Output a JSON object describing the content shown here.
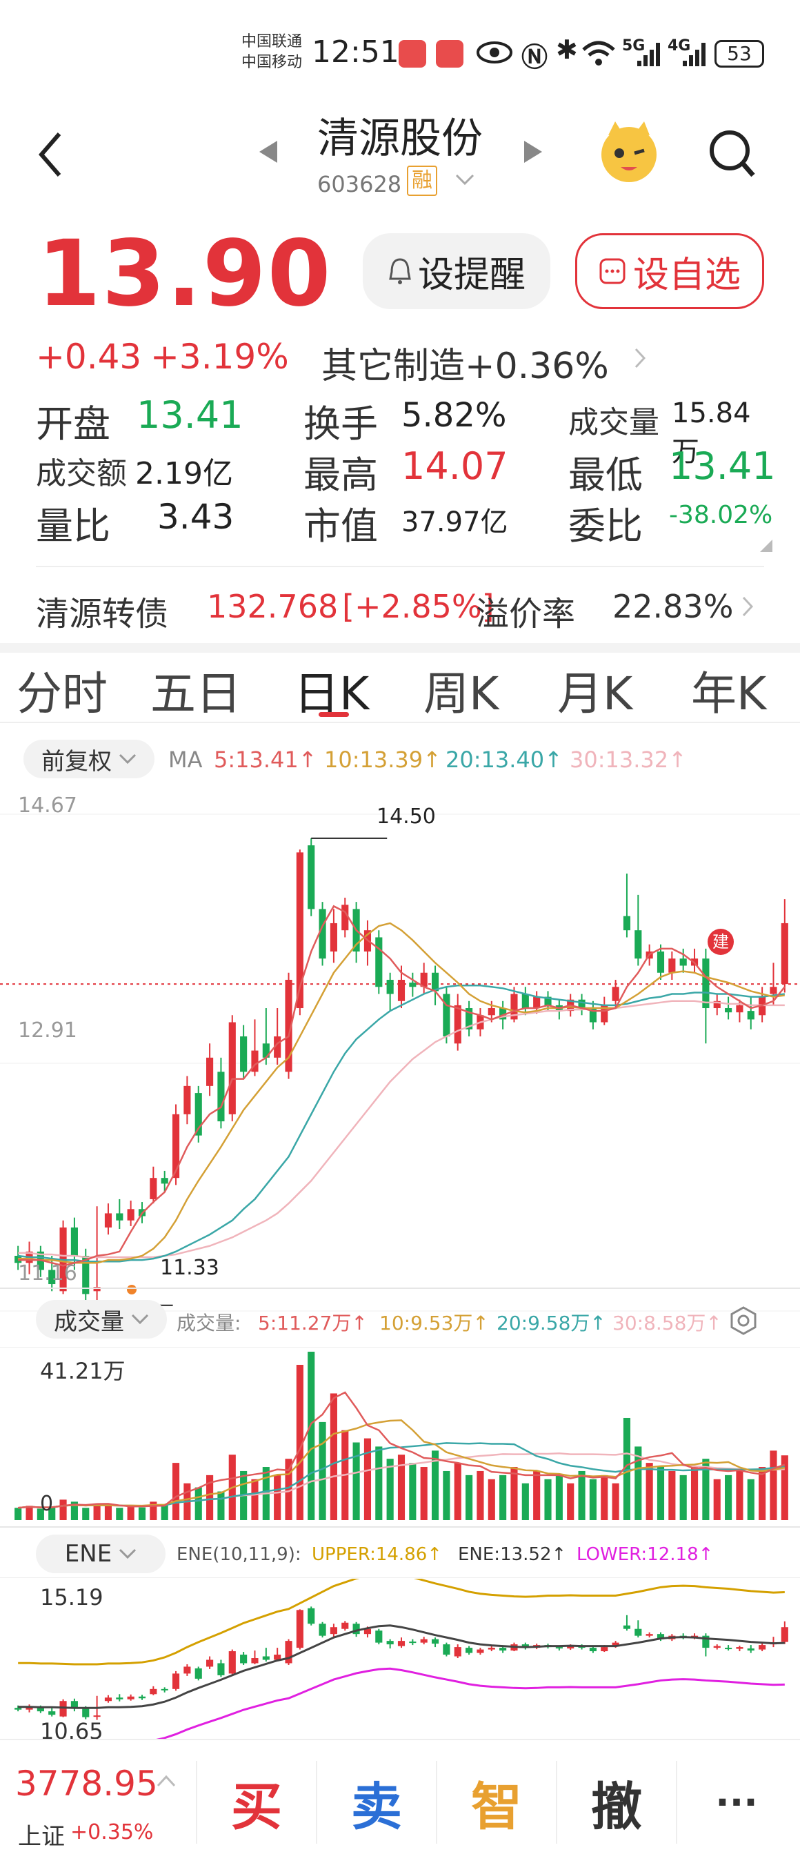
{
  "status": {
    "carrier1": "中国联通",
    "carrier2": "中国移动",
    "time": "12:51",
    "net1": "5G",
    "net2": "4G",
    "battery": "53"
  },
  "header": {
    "name": "清源股份",
    "code": "603628",
    "margin_tag": "融"
  },
  "quote": {
    "price": "13.90",
    "remind_label": "设提醒",
    "watch_label": "设自选",
    "change": "+0.43",
    "change_pct": "+3.19%",
    "sector": "其它制造+0.36%",
    "stats": [
      {
        "label": "开盘",
        "value": "13.41",
        "tone": "green"
      },
      {
        "label": "换手",
        "value": "5.82%",
        "tone": "black"
      },
      {
        "label": "成交量",
        "value": "15.84万",
        "tone": "black"
      },
      {
        "label": "成交额",
        "value": "2.19亿",
        "tone": "black"
      },
      {
        "label": "最高",
        "value": "14.07",
        "tone": "red"
      },
      {
        "label": "最低",
        "value": "13.41",
        "tone": "green"
      },
      {
        "label": "量比",
        "value": "3.43",
        "tone": "black"
      },
      {
        "label": "市值",
        "value": "37.97亿",
        "tone": "black"
      },
      {
        "label": "委比",
        "value": "-38.02%",
        "tone": "green"
      }
    ],
    "bond": {
      "name": "清源转债",
      "price": "132.768",
      "change": "[+2.85%]",
      "premium_label": "溢价率",
      "premium": "22.83%"
    }
  },
  "tabs": [
    "分时",
    "五日",
    "日K",
    "周K",
    "月K",
    "年K"
  ],
  "active_tab": 2,
  "kline": {
    "adjust": "前复权",
    "ma_label": "MA",
    "ma": [
      "5:13.41↑",
      "10:13.39↑",
      "20:13.40↑",
      "30:13.32↑"
    ],
    "y_max": "14.67",
    "y_mid": "12.91",
    "y_min": "11.16",
    "high_mark": "14.50",
    "low_mark": "11.33",
    "mark_tag": "建"
  },
  "volume": {
    "title": "成交量",
    "prefix": "成交量:",
    "ma": [
      "5:11.27万↑",
      "10:9.53万↑",
      "20:9.58万↑",
      "30:8.58万↑"
    ],
    "max_label": "41.21万",
    "zero": "0"
  },
  "ene": {
    "title": "ENE",
    "params": "ENE(10,11,9):",
    "upper": "UPPER:14.86↑",
    "mid": "ENE:13.52↑",
    "lower": "LOWER:12.18↑",
    "y_top": "15.19",
    "y_bottom": "10.65"
  },
  "footer": {
    "index_value": "3778.95",
    "index_name": "上证",
    "index_change": "+0.35%",
    "buy": "买",
    "sell": "卖",
    "smart": "智",
    "cancel": "撤",
    "more": "···"
  },
  "colors": {
    "up": "#e2333a",
    "down": "#1aaa55",
    "ma5": "#e05b5b",
    "ma10": "#d4a035",
    "ma20": "#3aa7a7",
    "ma30": "#f0b4bb",
    "upper": "#d4a000",
    "lower": "#e020e0",
    "ene": "#444444"
  },
  "chart_data": {
    "type": "candlestick",
    "y_range": [
      11.16,
      14.67
    ],
    "candles": [
      [
        11.55,
        11.5,
        11.62,
        11.45
      ],
      [
        11.5,
        11.58,
        11.65,
        11.42
      ],
      [
        11.58,
        11.45,
        11.62,
        11.4
      ],
      [
        11.45,
        11.35,
        11.55,
        11.3
      ],
      [
        11.3,
        11.75,
        11.8,
        11.28
      ],
      [
        11.75,
        11.55,
        11.82,
        11.45
      ],
      [
        11.55,
        11.28,
        11.6,
        11.22
      ],
      [
        11.3,
        11.33,
        11.9,
        11.2
      ],
      [
        11.75,
        11.85,
        11.92,
        11.7
      ],
      [
        11.85,
        11.8,
        11.95,
        11.74
      ],
      [
        11.8,
        11.88,
        11.94,
        11.76
      ],
      [
        11.88,
        11.83,
        11.93,
        11.78
      ],
      [
        11.95,
        12.1,
        12.18,
        11.92
      ],
      [
        12.1,
        12.06,
        12.15,
        12.0
      ],
      [
        12.1,
        12.55,
        12.62,
        12.05
      ],
      [
        12.55,
        12.75,
        12.82,
        12.48
      ],
      [
        12.7,
        12.4,
        12.75,
        12.35
      ],
      [
        12.75,
        12.95,
        13.05,
        12.68
      ],
      [
        12.85,
        12.5,
        12.95,
        12.45
      ],
      [
        12.55,
        13.2,
        13.25,
        12.5
      ],
      [
        13.1,
        12.85,
        13.18,
        12.8
      ],
      [
        12.85,
        13.0,
        13.22,
        12.82
      ],
      [
        13.05,
        12.95,
        13.3,
        12.9
      ],
      [
        12.95,
        13.1,
        13.3,
        12.9
      ],
      [
        12.85,
        13.5,
        13.55,
        12.8
      ],
      [
        13.3,
        14.4,
        14.42,
        13.25
      ],
      [
        14.45,
        14.0,
        14.5,
        13.95
      ],
      [
        14.0,
        13.65,
        14.05,
        13.6
      ],
      [
        13.7,
        13.9,
        14.0,
        13.62
      ],
      [
        13.85,
        14.03,
        14.08,
        13.8
      ],
      [
        14.0,
        13.7,
        14.05,
        13.62
      ],
      [
        13.7,
        13.85,
        13.92,
        13.6
      ],
      [
        13.8,
        13.45,
        13.85,
        13.4
      ],
      [
        13.5,
        13.4,
        13.55,
        13.28
      ],
      [
        13.35,
        13.5,
        13.6,
        13.3
      ],
      [
        13.48,
        13.45,
        13.55,
        13.38
      ],
      [
        13.45,
        13.55,
        13.62,
        13.4
      ],
      [
        13.55,
        13.42,
        13.6,
        13.32
      ],
      [
        13.4,
        13.1,
        13.45,
        13.05
      ],
      [
        13.05,
        13.32,
        13.4,
        13.0
      ],
      [
        13.3,
        13.15,
        13.35,
        13.1
      ],
      [
        13.15,
        13.25,
        13.3,
        13.1
      ],
      [
        13.25,
        13.3,
        13.35,
        13.2
      ],
      [
        13.3,
        13.22,
        13.35,
        13.15
      ],
      [
        13.22,
        13.4,
        13.45,
        13.2
      ],
      [
        13.4,
        13.3,
        13.45,
        13.25
      ],
      [
        13.3,
        13.38,
        13.42,
        13.26
      ],
      [
        13.38,
        13.32,
        13.42,
        13.28
      ],
      [
        13.32,
        13.28,
        13.36,
        13.22
      ],
      [
        13.28,
        13.36,
        13.4,
        13.24
      ],
      [
        13.36,
        13.3,
        13.4,
        13.25
      ],
      [
        13.3,
        13.2,
        13.35,
        13.15
      ],
      [
        13.2,
        13.32,
        13.38,
        13.18
      ],
      [
        13.35,
        13.45,
        13.5,
        13.3
      ],
      [
        13.95,
        13.85,
        14.25,
        13.8
      ],
      [
        13.85,
        13.65,
        14.1,
        13.6
      ],
      [
        13.65,
        13.7,
        13.75,
        13.6
      ],
      [
        13.7,
        13.55,
        13.75,
        13.5
      ],
      [
        13.55,
        13.65,
        13.7,
        13.5
      ],
      [
        13.65,
        13.6,
        13.72,
        13.55
      ],
      [
        13.6,
        13.65,
        13.72,
        13.55
      ],
      [
        13.65,
        13.3,
        13.72,
        13.05
      ],
      [
        13.3,
        13.35,
        13.4,
        13.25
      ],
      [
        13.3,
        13.27,
        13.38,
        13.22
      ],
      [
        13.27,
        13.32,
        13.36,
        13.2
      ],
      [
        13.28,
        13.22,
        13.38,
        13.15
      ],
      [
        13.25,
        13.38,
        13.45,
        13.2
      ],
      [
        13.4,
        13.45,
        13.62,
        13.32
      ],
      [
        13.47,
        13.9,
        14.07,
        13.41
      ]
    ],
    "volumes": [
      3,
      3.5,
      2.8,
      3.2,
      5,
      4.5,
      3,
      4,
      3.5,
      3,
      3.2,
      3.1,
      4.5,
      3.8,
      14,
      9,
      8,
      11,
      7,
      16,
      12,
      10,
      13,
      11,
      15,
      38,
      41.21,
      24,
      31,
      22,
      19,
      20,
      18,
      15,
      16,
      14,
      13,
      17,
      12,
      14,
      11,
      12,
      10,
      11,
      13,
      9,
      12,
      10,
      11,
      9,
      12,
      10,
      11,
      9,
      25,
      18,
      14,
      13,
      12,
      11,
      13,
      15,
      10,
      11,
      12,
      10,
      13,
      17,
      15.84
    ],
    "ma5": [
      11.52,
      11.52,
      11.52,
      11.5,
      11.48,
      11.5,
      11.52,
      11.55,
      11.56,
      11.58,
      11.72,
      11.85,
      11.93,
      12.0,
      12.15,
      12.32,
      12.45,
      12.55,
      12.6,
      12.8,
      12.8,
      12.9,
      12.95,
      13.05,
      13.1,
      13.45,
      13.7,
      13.88,
      14.02,
      13.98,
      13.85,
      13.78,
      13.72,
      13.65,
      13.55,
      13.5,
      13.45,
      13.42,
      13.32,
      13.3,
      13.27,
      13.25,
      13.22,
      13.25,
      13.28,
      13.3,
      13.3,
      13.32,
      13.3,
      13.32,
      13.3,
      13.28,
      13.28,
      13.3,
      13.45,
      13.55,
      13.68,
      13.72,
      13.72,
      13.68,
      13.62,
      13.52,
      13.45,
      13.4,
      13.35,
      13.3,
      13.32,
      13.35,
      13.45
    ],
    "ma10": [
      11.53,
      11.53,
      11.52,
      11.52,
      11.51,
      11.5,
      11.5,
      11.5,
      11.52,
      11.52,
      11.53,
      11.55,
      11.6,
      11.68,
      11.8,
      11.95,
      12.08,
      12.2,
      12.32,
      12.45,
      12.58,
      12.68,
      12.78,
      12.88,
      12.95,
      13.1,
      13.25,
      13.4,
      13.55,
      13.65,
      13.75,
      13.82,
      13.88,
      13.9,
      13.85,
      13.78,
      13.7,
      13.62,
      13.55,
      13.48,
      13.4,
      13.35,
      13.32,
      13.3,
      13.28,
      13.27,
      13.28,
      13.3,
      13.3,
      13.31,
      13.3,
      13.3,
      13.3,
      13.3,
      13.35,
      13.4,
      13.46,
      13.52,
      13.55,
      13.56,
      13.55,
      13.52,
      13.5,
      13.48,
      13.45,
      13.42,
      13.4,
      13.38,
      13.39
    ],
    "ma20": [
      11.55,
      11.54,
      11.54,
      11.53,
      11.52,
      11.52,
      11.51,
      11.51,
      11.51,
      11.51,
      11.52,
      11.52,
      11.53,
      11.55,
      11.58,
      11.62,
      11.66,
      11.7,
      11.75,
      11.8,
      11.88,
      11.95,
      12.05,
      12.15,
      12.25,
      12.4,
      12.55,
      12.7,
      12.85,
      12.98,
      13.08,
      13.15,
      13.22,
      13.28,
      13.32,
      13.36,
      13.4,
      13.43,
      13.45,
      13.46,
      13.46,
      13.46,
      13.45,
      13.44,
      13.42,
      13.4,
      13.38,
      13.37,
      13.36,
      13.35,
      13.34,
      13.33,
      13.32,
      13.32,
      13.33,
      13.35,
      13.37,
      13.38,
      13.4,
      13.4,
      13.41,
      13.41,
      13.4,
      13.4,
      13.39,
      13.38,
      13.38,
      13.39,
      13.4
    ],
    "ma30": [
      11.57,
      11.57,
      11.56,
      11.56,
      11.55,
      11.55,
      11.54,
      11.54,
      11.54,
      11.54,
      11.54,
      11.54,
      11.54,
      11.55,
      11.56,
      11.58,
      11.6,
      11.62,
      11.65,
      11.68,
      11.72,
      11.76,
      11.8,
      11.85,
      11.92,
      12.0,
      12.08,
      12.18,
      12.28,
      12.38,
      12.48,
      12.58,
      12.68,
      12.78,
      12.86,
      12.94,
      13.0,
      13.06,
      13.1,
      13.14,
      13.17,
      13.2,
      13.22,
      13.24,
      13.25,
      13.26,
      13.27,
      13.28,
      13.28,
      13.29,
      13.29,
      13.3,
      13.3,
      13.3,
      13.31,
      13.32,
      13.33,
      13.34,
      13.35,
      13.35,
      13.35,
      13.34,
      13.34,
      13.33,
      13.33,
      13.32,
      13.32,
      13.32,
      13.32
    ]
  }
}
